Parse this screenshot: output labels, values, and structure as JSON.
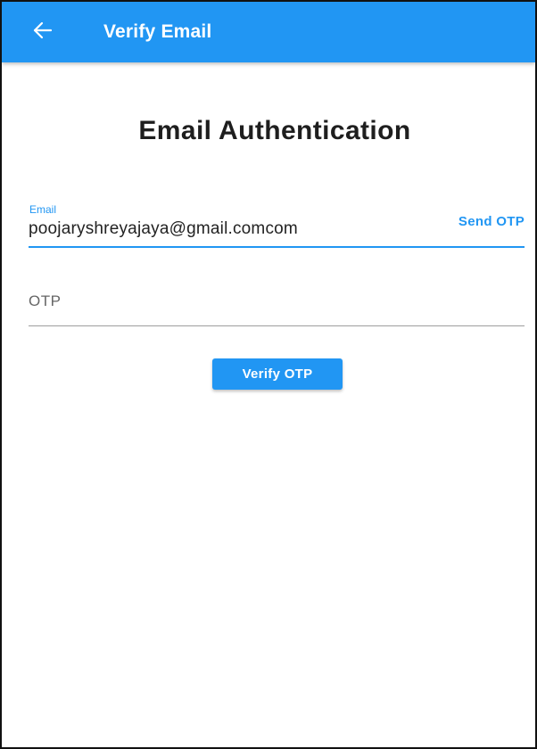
{
  "appbar": {
    "back_icon": "arrow-left-icon",
    "title": "Verify Email",
    "color": "#2196f3"
  },
  "main": {
    "heading": "Email Authentication",
    "email_field": {
      "label": "Email",
      "value": "poojaryshreyajaya@gmail.comcom",
      "action_label": "Send OTP"
    },
    "otp_field": {
      "placeholder": "OTP",
      "value": ""
    },
    "verify_button_label": "Verify OTP"
  }
}
